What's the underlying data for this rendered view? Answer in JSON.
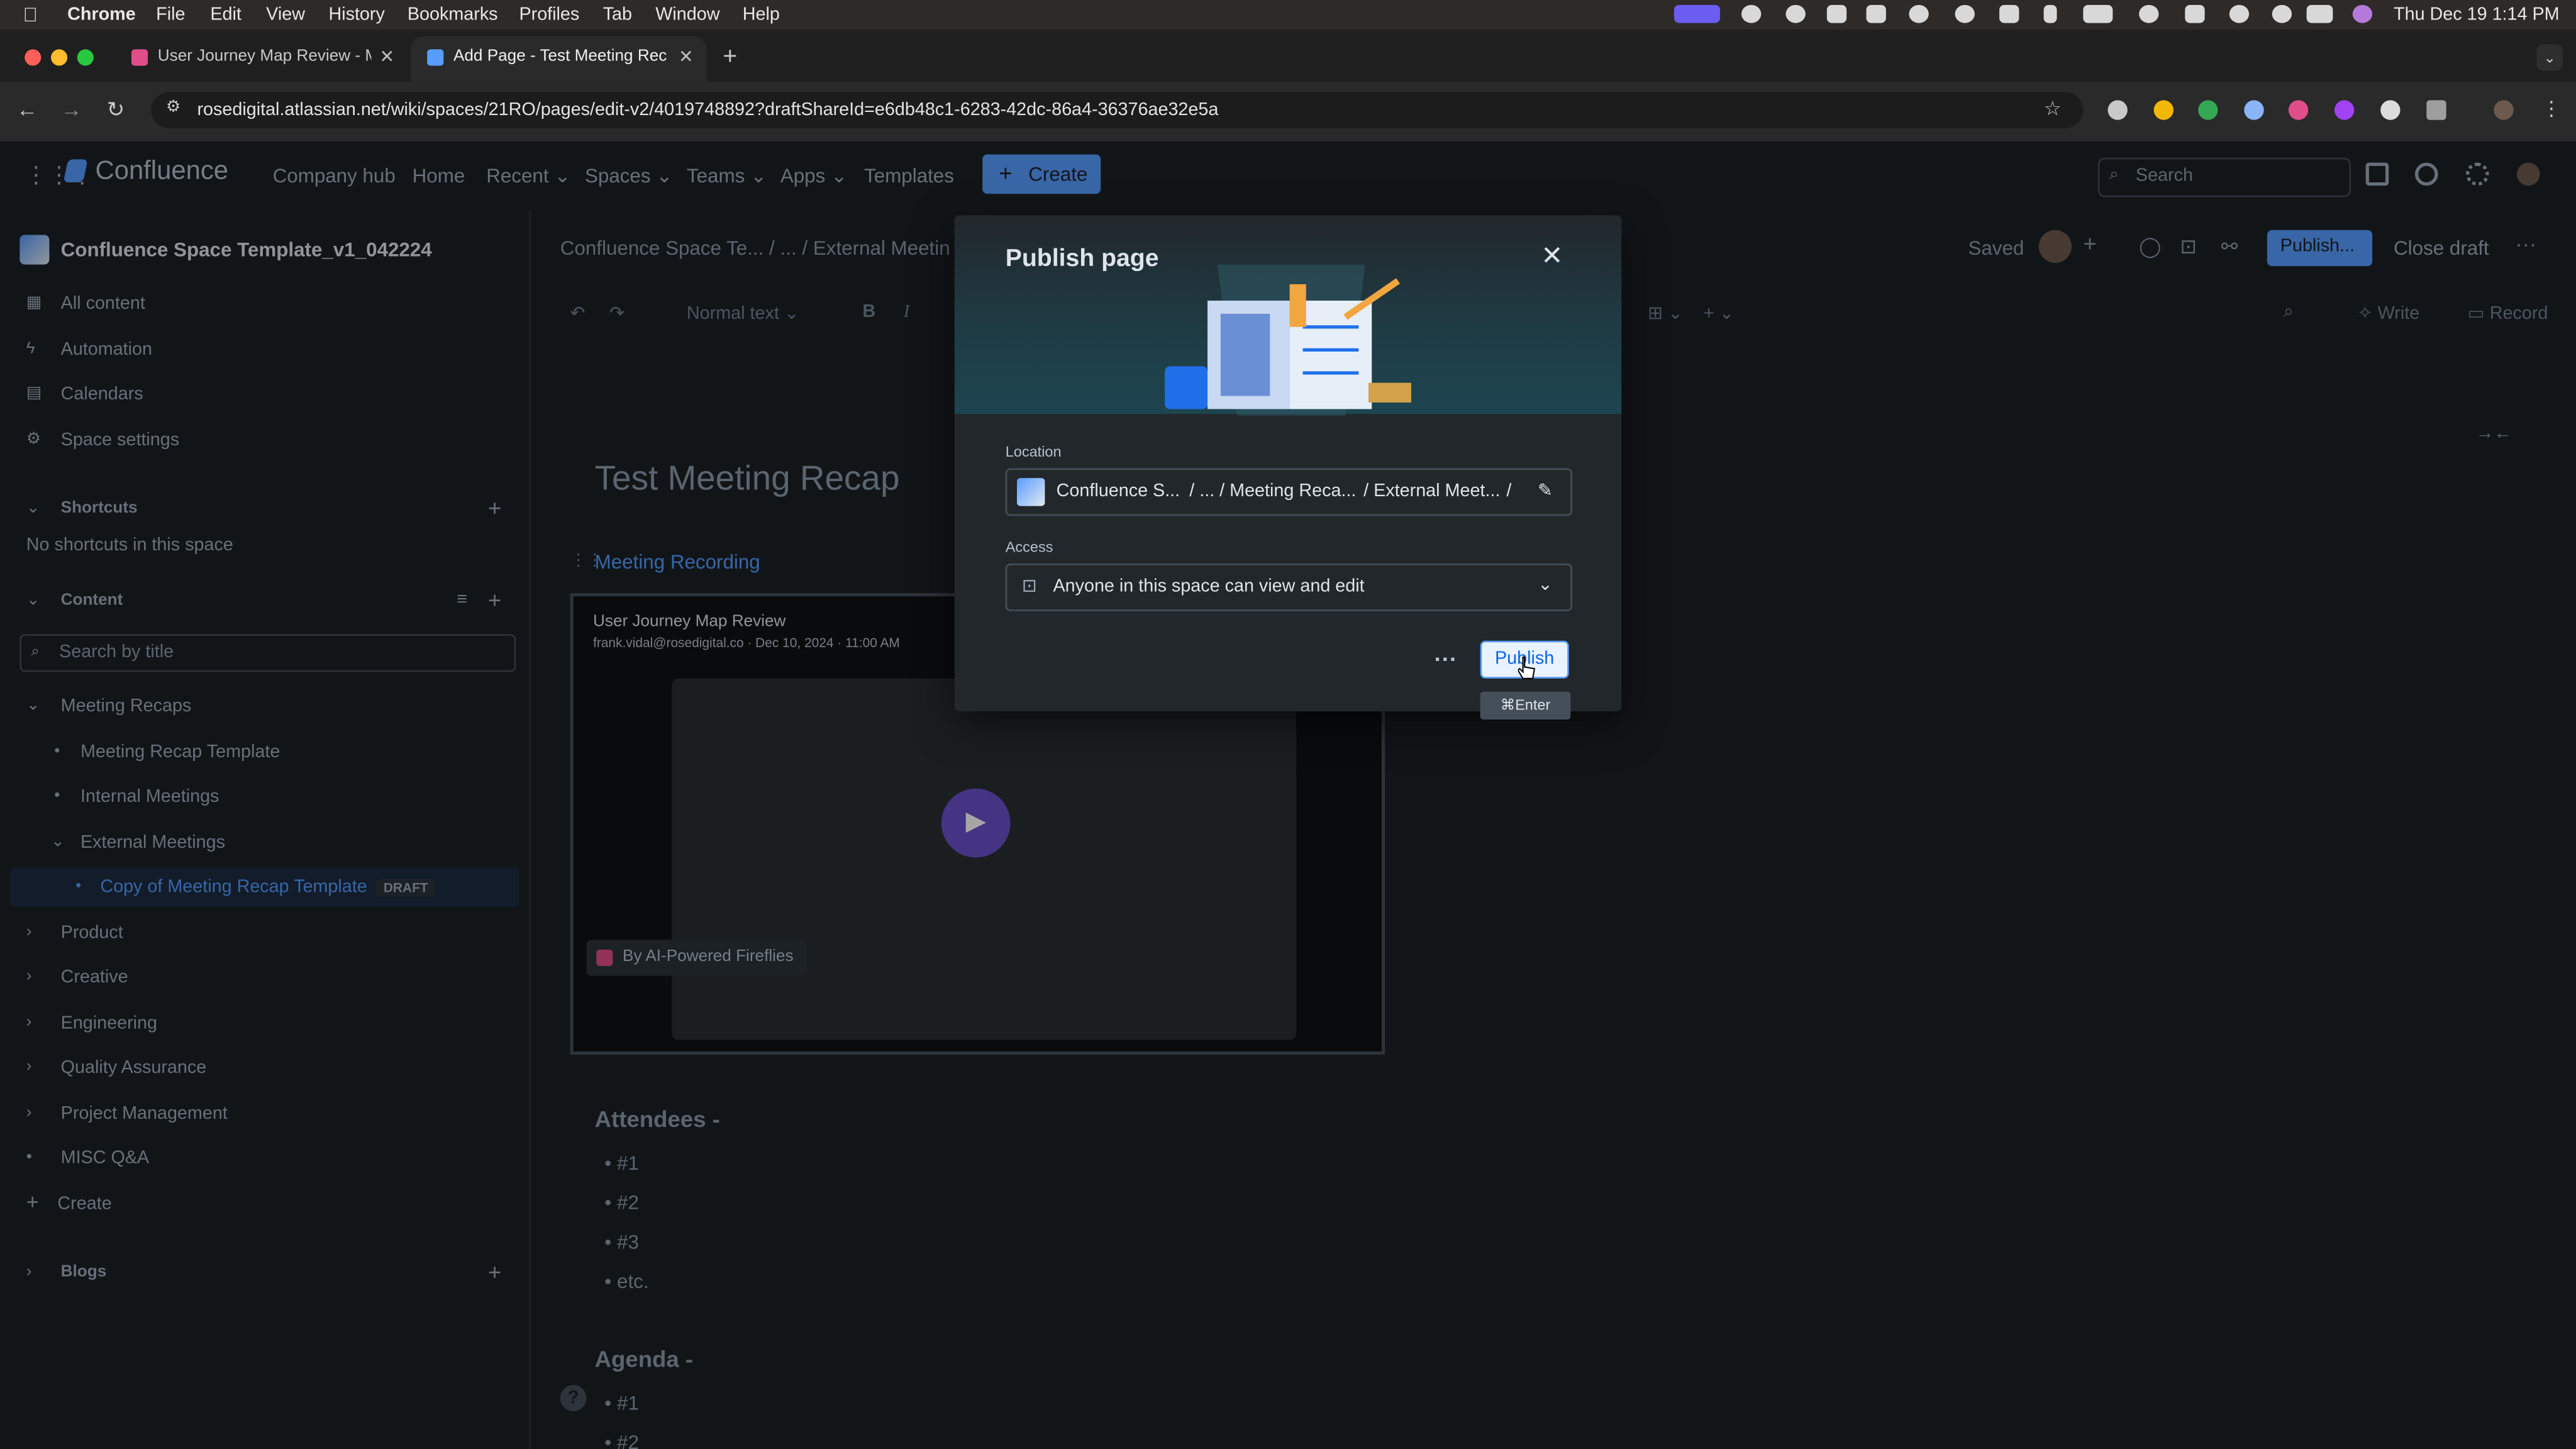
{
  "macos": {
    "app": "Chrome",
    "menus": [
      "File",
      "Edit",
      "View",
      "History",
      "Bookmarks",
      "Profiles",
      "Tab",
      "Window",
      "Help"
    ],
    "clock": "Thu Dec 19  1:14 PM"
  },
  "browser": {
    "tabs": [
      {
        "title": "User Journey Map Review - M",
        "favicon": "fireflies-icon",
        "color": "#e04e8a"
      },
      {
        "title": "Add Page - Test Meeting Rec",
        "favicon": "confluence-icon",
        "color": "#579dff"
      }
    ],
    "url": "rosedigital.atlassian.net/wiki/spaces/21RO/pages/edit-v2/4019748892?draftShareId=e6db48c1-6283-42dc-86a4-36376ae32e5a"
  },
  "header": {
    "product": "Confluence",
    "nav": [
      "Company hub",
      "Home",
      "Recent",
      "Spaces",
      "Teams",
      "Apps",
      "Templates"
    ],
    "create": "Create",
    "search_placeholder": "Search"
  },
  "sidebar": {
    "space_name": "Confluence Space Template_v1_042224",
    "top_items": [
      "All content",
      "Automation",
      "Calendars",
      "Space settings"
    ],
    "shortcuts_label": "Shortcuts",
    "shortcuts_empty": "No shortcuts in this space",
    "content_label": "Content",
    "search_placeholder": "Search by title",
    "tree": [
      {
        "label": "Meeting Recaps",
        "level": 0
      },
      {
        "label": "Meeting Recap Template",
        "level": 1
      },
      {
        "label": "Internal Meetings",
        "level": 1
      },
      {
        "label": "External Meetings",
        "level": 1
      },
      {
        "label": "Copy of Meeting Recap Template",
        "level": 2,
        "badge": "DRAFT"
      },
      {
        "label": "Product",
        "level": 0
      },
      {
        "label": "Creative",
        "level": 0
      },
      {
        "label": "Engineering",
        "level": 0
      },
      {
        "label": "Quality Assurance",
        "level": 0
      },
      {
        "label": "Project Management",
        "level": 0
      },
      {
        "label": "MISC Q&A",
        "level": 0
      }
    ],
    "create_label": "Create",
    "blogs_label": "Blogs"
  },
  "editor": {
    "breadcrumb": [
      "Confluence Space Te...",
      "...",
      "External Meetin"
    ],
    "status": "Saved",
    "publish_btn": "Publish...",
    "close_draft": "Close draft",
    "toolbar_text_style": "Normal text",
    "write": "Write",
    "record": "Record",
    "page_title": "Test Meeting Recap",
    "section_link": "Meeting Recording",
    "video_title": "User Journey Map Review",
    "video_meta": "frank.vidal@rosedigital.co · Dec 10, 2024 · 11:00 AM",
    "video_badge": "By AI-Powered Fireflies",
    "attendees_heading": "Attendees -",
    "attendees": [
      "#1",
      "#2",
      "#3",
      "etc."
    ],
    "agenda_heading": "Agenda -",
    "agenda": [
      "#1",
      "#2"
    ]
  },
  "modal": {
    "title": "Publish page",
    "location_label": "Location",
    "location_parts": [
      "Confluence S...",
      "/ ... / Meeting Reca...",
      "/ External Meet...",
      "/"
    ],
    "access_label": "Access",
    "access_value": "Anyone in this space can view and edit",
    "publish": "Publish",
    "shortcut": "⌘Enter"
  }
}
